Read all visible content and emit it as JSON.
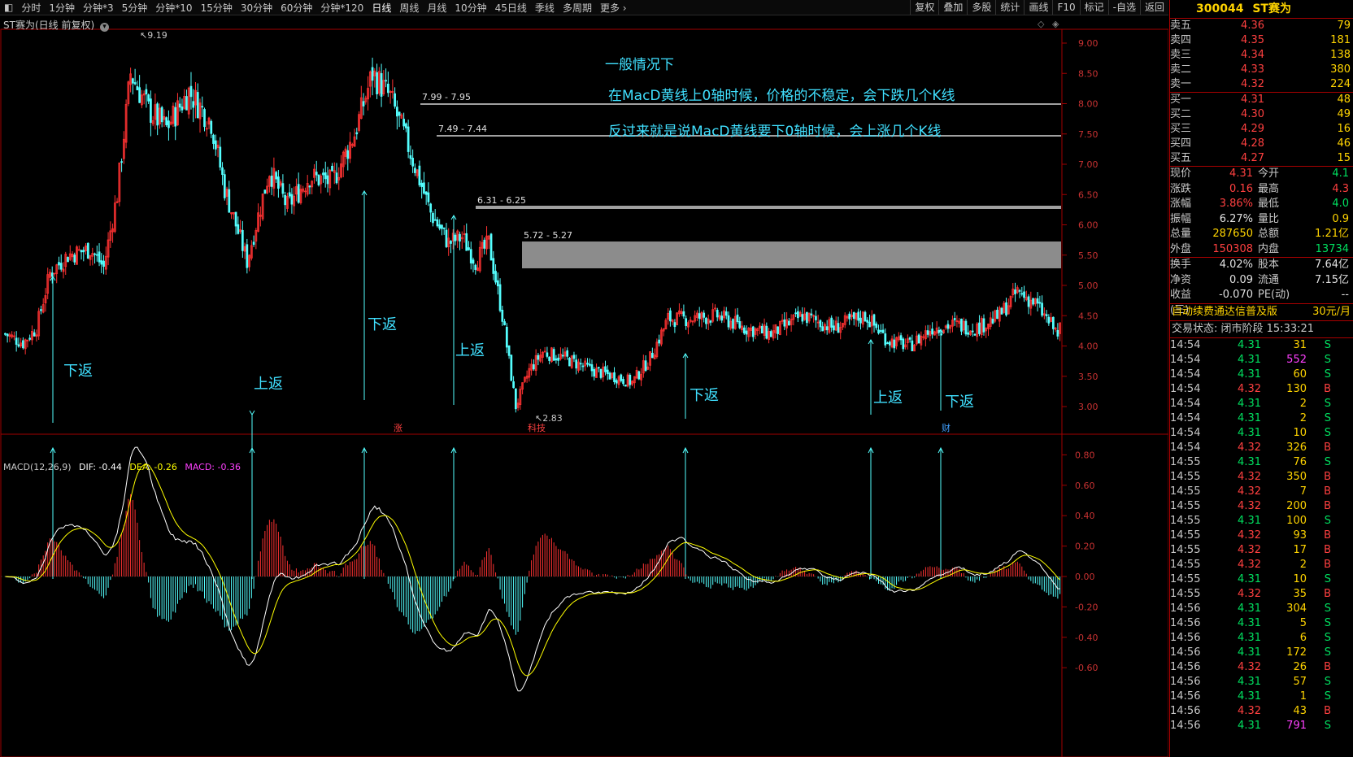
{
  "toolbar": {
    "periods": [
      "分时",
      "1分钟",
      "分钟*3",
      "5分钟",
      "分钟*10",
      "15分钟",
      "30分钟",
      "60分钟",
      "分钟*120",
      "日线",
      "周线",
      "月线",
      "10分钟",
      "45日线",
      "季线",
      "多周期",
      "更多"
    ],
    "active": "日线",
    "right_buttons": [
      "复权",
      "叠加",
      "多股",
      "统计",
      "画线",
      "F10",
      "标记",
      "-自选",
      "返回"
    ]
  },
  "chart": {
    "title": "ST赛为(日线 前复权)",
    "price_ticks": [
      "9.00",
      "8.50",
      "8.00",
      "7.50",
      "7.00",
      "6.50",
      "6.00",
      "5.50",
      "5.00",
      "4.50",
      "4.00",
      "3.50",
      "3.00"
    ],
    "high_label": "9.19",
    "low_label": "2.83",
    "annotations": [
      {
        "text": "一般情况下"
      },
      {
        "text": "在MacD黄线上0轴时候，价格的不稳定，会下跌几个K线"
      },
      {
        "text": "反过来就是说MacD黄线要下0轴时候，会上涨几个K线"
      }
    ],
    "levels": [
      {
        "label": "7.99 - 7.95"
      },
      {
        "label": "7.49 - 7.44"
      },
      {
        "label": "6.31 - 6.25"
      },
      {
        "label": "5.72 - 5.27"
      }
    ],
    "signals": [
      "下返",
      "上返",
      "下返",
      "上返",
      "下返",
      "上返",
      "下返"
    ],
    "markers": [
      "涨",
      "科技",
      "财"
    ]
  },
  "macd": {
    "title": "MACD(12,26,9)",
    "dif_label": "DIF: -0.44",
    "dea_label": "DEA: -0.26",
    "macd_label": "MACD: -0.36",
    "ticks": [
      "0.80",
      "0.60",
      "0.40",
      "0.20",
      "0.00",
      "-0.20",
      "-0.40",
      "-0.60"
    ]
  },
  "panel": {
    "code": "300044",
    "name": "ST赛为",
    "asks": [
      {
        "label": "卖五",
        "price": "4.36",
        "vol": "79"
      },
      {
        "label": "卖四",
        "price": "4.35",
        "vol": "181"
      },
      {
        "label": "卖三",
        "price": "4.34",
        "vol": "138"
      },
      {
        "label": "卖二",
        "price": "4.33",
        "vol": "380"
      },
      {
        "label": "卖一",
        "price": "4.32",
        "vol": "224"
      }
    ],
    "bids": [
      {
        "label": "买一",
        "price": "4.31",
        "vol": "48"
      },
      {
        "label": "买二",
        "price": "4.30",
        "vol": "49"
      },
      {
        "label": "买三",
        "price": "4.29",
        "vol": "16"
      },
      {
        "label": "买四",
        "price": "4.28",
        "vol": "46"
      },
      {
        "label": "买五",
        "price": "4.27",
        "vol": "15"
      }
    ],
    "stats": [
      {
        "l": "现价",
        "v": "4.31",
        "vc": "red",
        "l2": "今开",
        "v2": "4.1",
        "v2c": "grn"
      },
      {
        "l": "涨跌",
        "v": "0.16",
        "vc": "red",
        "l2": "最高",
        "v2": "4.3",
        "v2c": "red"
      },
      {
        "l": "涨幅",
        "v": "3.86%",
        "vc": "red",
        "l2": "最低",
        "v2": "4.0",
        "v2c": "grn"
      },
      {
        "l": "振幅",
        "v": "6.27%",
        "vc": "wht",
        "l2": "量比",
        "v2": "0.9",
        "v2c": "yel"
      },
      {
        "l": "总量",
        "v": "287650",
        "vc": "yel",
        "l2": "总额",
        "v2": "1.21亿",
        "v2c": "yel"
      },
      {
        "l": "外盘",
        "v": "150308",
        "vc": "red",
        "l2": "内盘",
        "v2": "13734",
        "v2c": "grn"
      }
    ],
    "stats2": [
      {
        "l": "换手",
        "v": "4.02%",
        "vc": "wht",
        "l2": "股本",
        "v2": "7.64亿",
        "v2c": "wht"
      },
      {
        "l": "净资",
        "v": "0.09",
        "vc": "wht",
        "l2": "流通",
        "v2": "7.15亿",
        "v2c": "wht"
      },
      {
        "l": "收益(三)",
        "v": "-0.070",
        "vc": "wht",
        "l2": "PE(动)",
        "v2": "--",
        "v2c": "wht"
      }
    ],
    "ad_text": "自动续费通达信普及版",
    "ad_price": "30元/月",
    "status": "交易状态: 闭市阶段 15:33:21",
    "ticks": [
      {
        "t": "14:54",
        "p": "4.31",
        "v": "31",
        "s": "S"
      },
      {
        "t": "14:54",
        "p": "4.31",
        "v": "552",
        "s": "S"
      },
      {
        "t": "14:54",
        "p": "4.31",
        "v": "60",
        "s": "S"
      },
      {
        "t": "14:54",
        "p": "4.32",
        "v": "130",
        "s": "B"
      },
      {
        "t": "14:54",
        "p": "4.31",
        "v": "2",
        "s": "S"
      },
      {
        "t": "14:54",
        "p": "4.31",
        "v": "2",
        "s": "S"
      },
      {
        "t": "14:54",
        "p": "4.31",
        "v": "10",
        "s": "S"
      },
      {
        "t": "14:54",
        "p": "4.32",
        "v": "326",
        "s": "B"
      },
      {
        "t": "14:55",
        "p": "4.31",
        "v": "76",
        "s": "S"
      },
      {
        "t": "14:55",
        "p": "4.32",
        "v": "350",
        "s": "B"
      },
      {
        "t": "14:55",
        "p": "4.32",
        "v": "7",
        "s": "B"
      },
      {
        "t": "14:55",
        "p": "4.32",
        "v": "200",
        "s": "B"
      },
      {
        "t": "14:55",
        "p": "4.31",
        "v": "100",
        "s": "S"
      },
      {
        "t": "14:55",
        "p": "4.32",
        "v": "93",
        "s": "B"
      },
      {
        "t": "14:55",
        "p": "4.32",
        "v": "17",
        "s": "B"
      },
      {
        "t": "14:55",
        "p": "4.32",
        "v": "2",
        "s": "B"
      },
      {
        "t": "14:55",
        "p": "4.31",
        "v": "10",
        "s": "S"
      },
      {
        "t": "14:55",
        "p": "4.32",
        "v": "35",
        "s": "B"
      },
      {
        "t": "14:56",
        "p": "4.31",
        "v": "304",
        "s": "S"
      },
      {
        "t": "14:56",
        "p": "4.31",
        "v": "5",
        "s": "S"
      },
      {
        "t": "14:56",
        "p": "4.31",
        "v": "6",
        "s": "S"
      },
      {
        "t": "14:56",
        "p": "4.31",
        "v": "172",
        "s": "S"
      },
      {
        "t": "14:56",
        "p": "4.32",
        "v": "26",
        "s": "B"
      },
      {
        "t": "14:56",
        "p": "4.31",
        "v": "57",
        "s": "S"
      },
      {
        "t": "14:56",
        "p": "4.31",
        "v": "1",
        "s": "S"
      },
      {
        "t": "14:56",
        "p": "4.32",
        "v": "43",
        "s": "B"
      },
      {
        "t": "14:56",
        "p": "4.31",
        "v": "791",
        "s": "S"
      }
    ]
  },
  "colors": {
    "up": "#ff3232",
    "down": "#54ffff",
    "dif": "#ffffff",
    "dea": "#ffff00",
    "grid": "#a00000",
    "level": "#a0a0a0"
  }
}
